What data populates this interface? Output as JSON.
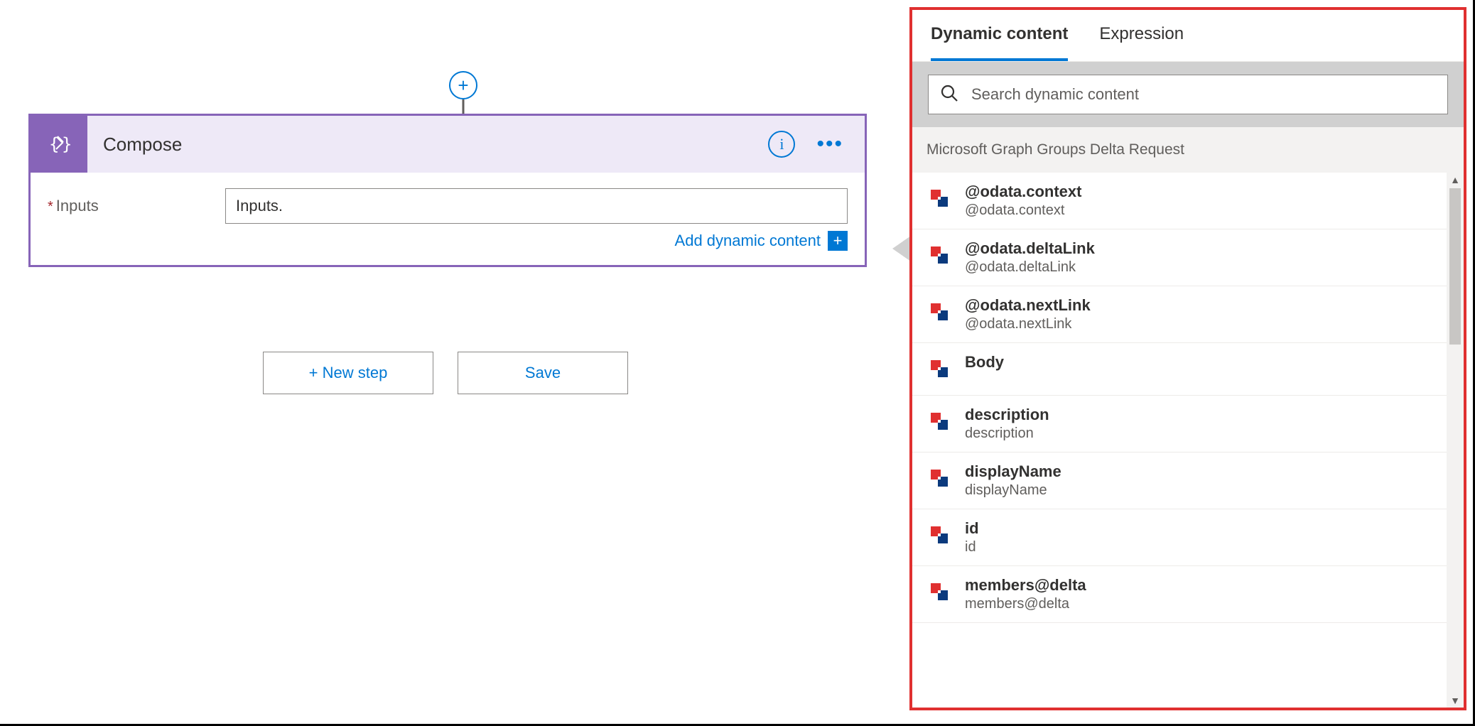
{
  "compose": {
    "title": "Compose",
    "inputs_label": "Inputs",
    "inputs_value": "Inputs.",
    "add_dynamic_label": "Add dynamic content"
  },
  "footer": {
    "new_step": "+ New step",
    "save": "Save"
  },
  "dc": {
    "tabs": {
      "dynamic": "Dynamic content",
      "expression": "Expression"
    },
    "search_placeholder": "Search dynamic content",
    "section": "Microsoft Graph Groups Delta Request",
    "items": [
      {
        "title": "@odata.context",
        "sub": "@odata.context"
      },
      {
        "title": "@odata.deltaLink",
        "sub": "@odata.deltaLink"
      },
      {
        "title": "@odata.nextLink",
        "sub": "@odata.nextLink"
      },
      {
        "title": "Body",
        "sub": ""
      },
      {
        "title": "description",
        "sub": "description"
      },
      {
        "title": "displayName",
        "sub": "displayName"
      },
      {
        "title": "id",
        "sub": "id"
      },
      {
        "title": "members@delta",
        "sub": "members@delta"
      }
    ]
  }
}
